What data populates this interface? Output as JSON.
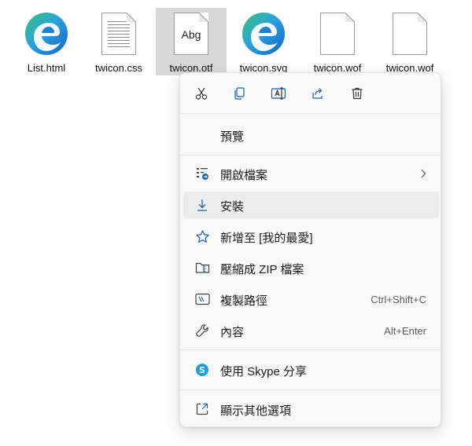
{
  "files": [
    {
      "name": "List.html",
      "icon": "edge-icon"
    },
    {
      "name": "twicon.css",
      "icon": "text-document-icon"
    },
    {
      "name": "twicon.otf",
      "icon": "font-file-icon",
      "preview_text": "Abg",
      "selected": true
    },
    {
      "name": "twicon.svg",
      "icon": "edge-icon"
    },
    {
      "name": "twicon.wof",
      "icon": "blank-document-icon"
    },
    {
      "name": "twicon.wof",
      "icon": "blank-document-icon"
    }
  ],
  "menu": {
    "toolbar": [
      "cut-icon",
      "copy-icon",
      "rename-icon",
      "share-icon",
      "delete-icon"
    ],
    "items": [
      {
        "label": "預覽"
      },
      {
        "label": "開啟檔案",
        "icon": "open-with-icon",
        "has_submenu": true
      },
      {
        "label": "安裝",
        "icon": "download-icon",
        "highlighted": true
      },
      {
        "label": "新增至 [我的最愛]",
        "icon": "star-icon"
      },
      {
        "label": "壓縮成 ZIP 檔案",
        "icon": "zip-folder-icon"
      },
      {
        "label": "複製路徑",
        "icon": "copy-path-icon",
        "shortcut": "Ctrl+Shift+C"
      },
      {
        "label": "內容",
        "icon": "wrench-icon",
        "shortcut": "Alt+Enter"
      },
      {
        "label": "使用 Skype 分享",
        "icon": "skype-icon"
      },
      {
        "label": "顯示其他選項",
        "icon": "more-options-icon"
      }
    ]
  },
  "colors": {
    "accent": "#1a5fb4",
    "skype": "#1d9de0",
    "edge_blue": "#1e7fd6",
    "edge_green": "#4fc36a"
  }
}
